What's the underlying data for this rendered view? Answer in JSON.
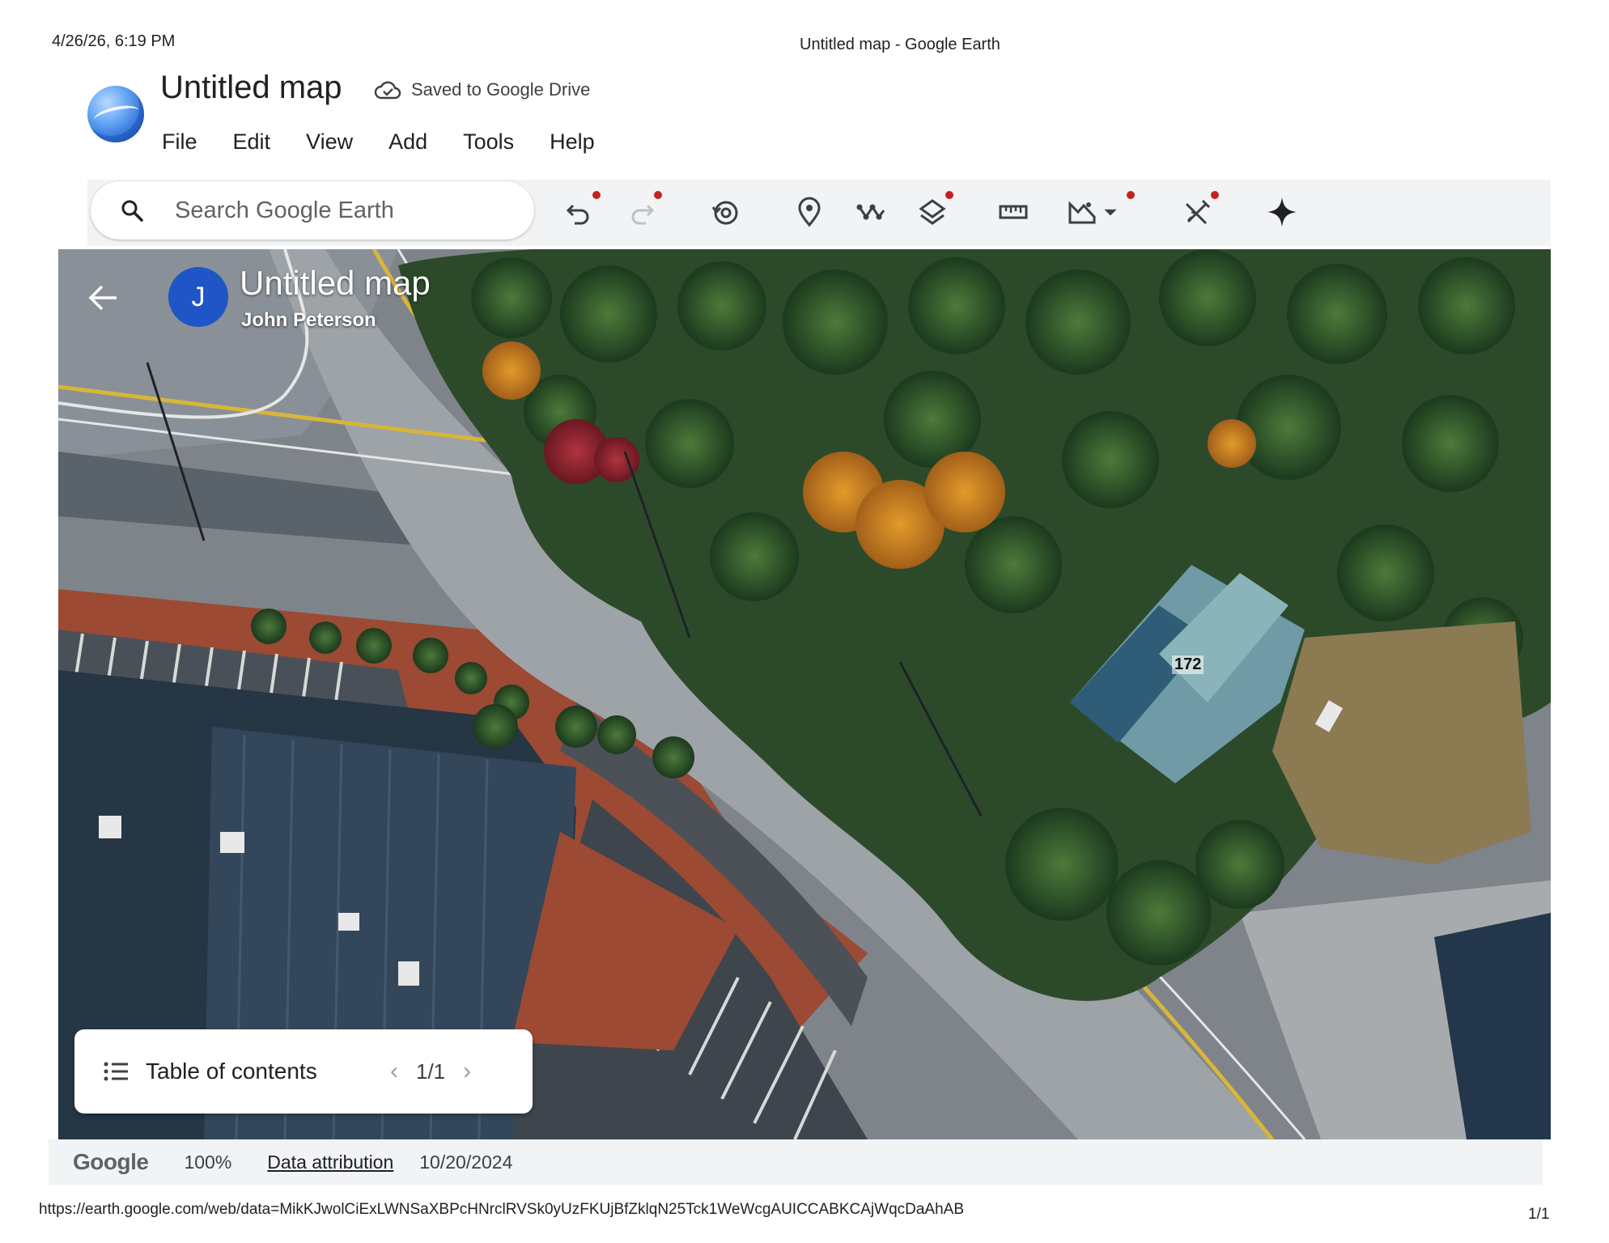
{
  "print": {
    "datetime": "4/26/26, 6:19 PM",
    "title": "Untitled map - Google Earth",
    "url": "https://earth.google.com/web/data=MikKJwolCiExLWNSaXBPcHNrclRVSk0yUzFKUjBfZklqN25Tck1WeWcgAUICCABKCAjWqcDaAhAB",
    "page": "1/1"
  },
  "header": {
    "title": "Untitled map",
    "saved_status": "Saved to Google Drive",
    "menu": [
      "File",
      "Edit",
      "View",
      "Add",
      "Tools",
      "Help"
    ]
  },
  "toolbar": {
    "search_placeholder": "Search Google Earth",
    "tools": [
      "undo-icon",
      "redo-icon",
      "history-icon",
      "placemark-icon",
      "path-icon",
      "layers-icon",
      "ruler-icon",
      "map-style-icon",
      "draw-tools-icon",
      "gemini-sparkle-icon"
    ],
    "accent": "#c5221f"
  },
  "map": {
    "title": "Untitled map",
    "owner": "John Peterson",
    "avatar_letter": "J",
    "avatar_color": "#1f55c6",
    "house_number": "172"
  },
  "toc": {
    "label": "Table of contents",
    "page": "1/1"
  },
  "status": {
    "brand": "Google",
    "zoom": "100%",
    "attribution": "Data attribution",
    "imagery_date": "10/20/2024"
  }
}
